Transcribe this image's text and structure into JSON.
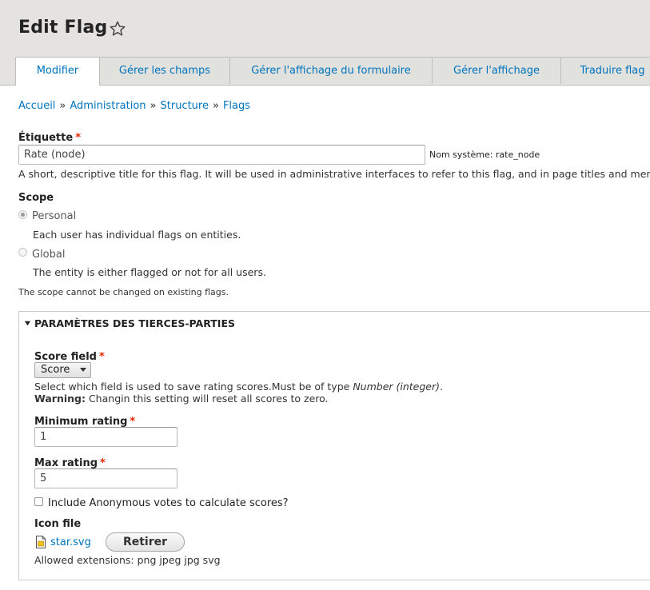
{
  "header": {
    "title": "Edit Flag",
    "tabs": [
      "Modifier",
      "Gérer les champs",
      "Gérer l'affichage du formulaire",
      "Gérer l'affichage",
      "Traduire flag"
    ]
  },
  "breadcrumb": [
    "Accueil",
    "Administration",
    "Structure",
    "Flags"
  ],
  "form": {
    "label_field": {
      "label": "Étiquette",
      "required": "*",
      "value": "Rate (node)",
      "machine_name": "Nom système: rate_node",
      "description": "A short, descriptive title for this flag. It will be used in administrative interfaces to refer to this flag, and in page titles and menu"
    },
    "scope": {
      "label": "Scope",
      "options": [
        {
          "label": "Personal",
          "description": "Each user has individual flags on entities.",
          "checked": true
        },
        {
          "label": "Global",
          "description": "The entity is either flagged or not for all users.",
          "checked": false
        }
      ],
      "note": "The scope cannot be changed on existing flags."
    },
    "third_party": {
      "legend": "PARAMÈTRES DES TIERCES-PARTIES",
      "score_field": {
        "label": "Score field",
        "required": "*",
        "selected": "Score",
        "description_prefix": "Select which field is used to save rating scores.Must be of type ",
        "description_type": "Number (integer)",
        "description_suffix": ".",
        "warning_label": "Warning:",
        "warning_text": " Changin this setting will reset all scores to zero."
      },
      "min_rating": {
        "label": "Minimum rating",
        "required": "*",
        "value": "1"
      },
      "max_rating": {
        "label": "Max rating",
        "required": "*",
        "value": "5"
      },
      "anonymous": {
        "label": "Include Anonymous votes to calculate scores?",
        "checked": false
      },
      "icon_file": {
        "label": "Icon file",
        "filename": "star.svg",
        "remove_label": "Retirer",
        "allowed": "Allowed extensions: png jpeg jpg svg"
      }
    }
  },
  "colors": {
    "link": "#0074bd",
    "required": "#e62600",
    "header_bg": "#e4e3e0"
  }
}
